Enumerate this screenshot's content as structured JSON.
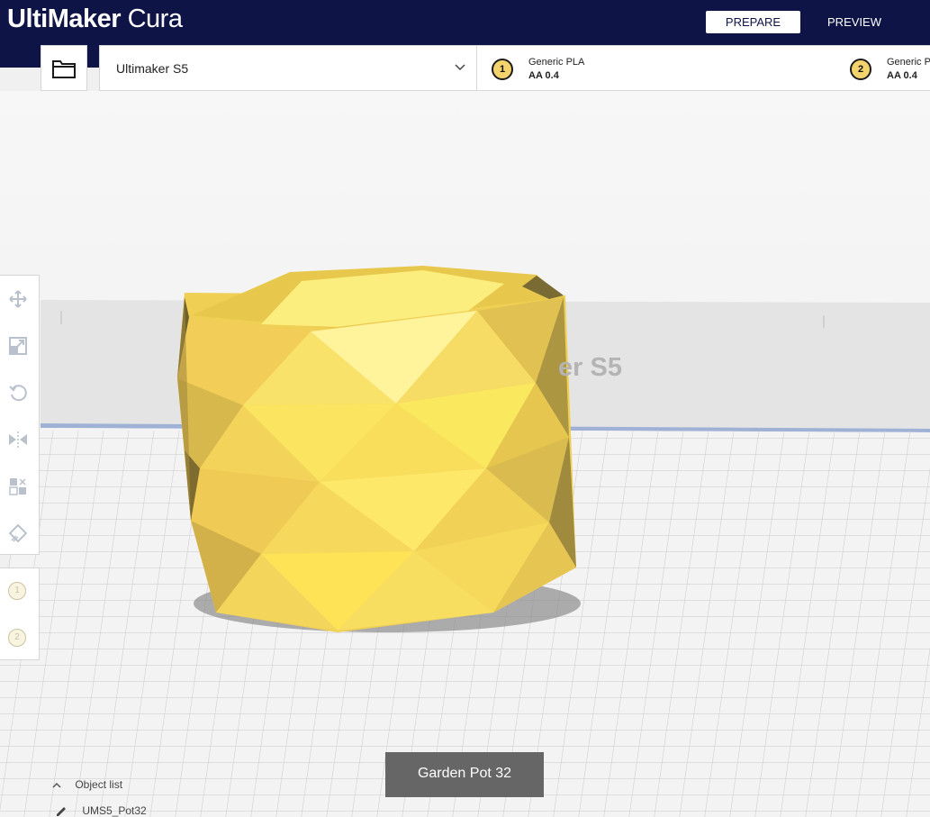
{
  "app": {
    "brand_bold": "UltiMaker",
    "brand_light": "Cura"
  },
  "stages": [
    {
      "label": "PREPARE",
      "active": true
    },
    {
      "label": "PREVIEW",
      "active": false
    }
  ],
  "toolbar": {
    "open_icon": "folder-icon",
    "printer": "Ultimaker S5",
    "printer_dropdown_icon": "chevron-down-icon"
  },
  "extruders": [
    {
      "index": "1",
      "material": "Generic PLA",
      "core": "AA 0.4"
    },
    {
      "index": "2",
      "material": "Generic P",
      "core": "AA 0.4"
    }
  ],
  "viewport": {
    "build_plate_label": "er S5",
    "model_color": "#f5d64a"
  },
  "tools": [
    {
      "name": "move-icon"
    },
    {
      "name": "scale-icon"
    },
    {
      "name": "rotate-icon"
    },
    {
      "name": "mirror-icon"
    },
    {
      "name": "per-model-settings-icon"
    },
    {
      "name": "support-blocker-icon"
    }
  ],
  "extruder_tools": [
    "1",
    "2"
  ],
  "object": {
    "name": "Garden Pot 32",
    "list_header": "Object list",
    "list_item": "UMS5_Pot32"
  }
}
